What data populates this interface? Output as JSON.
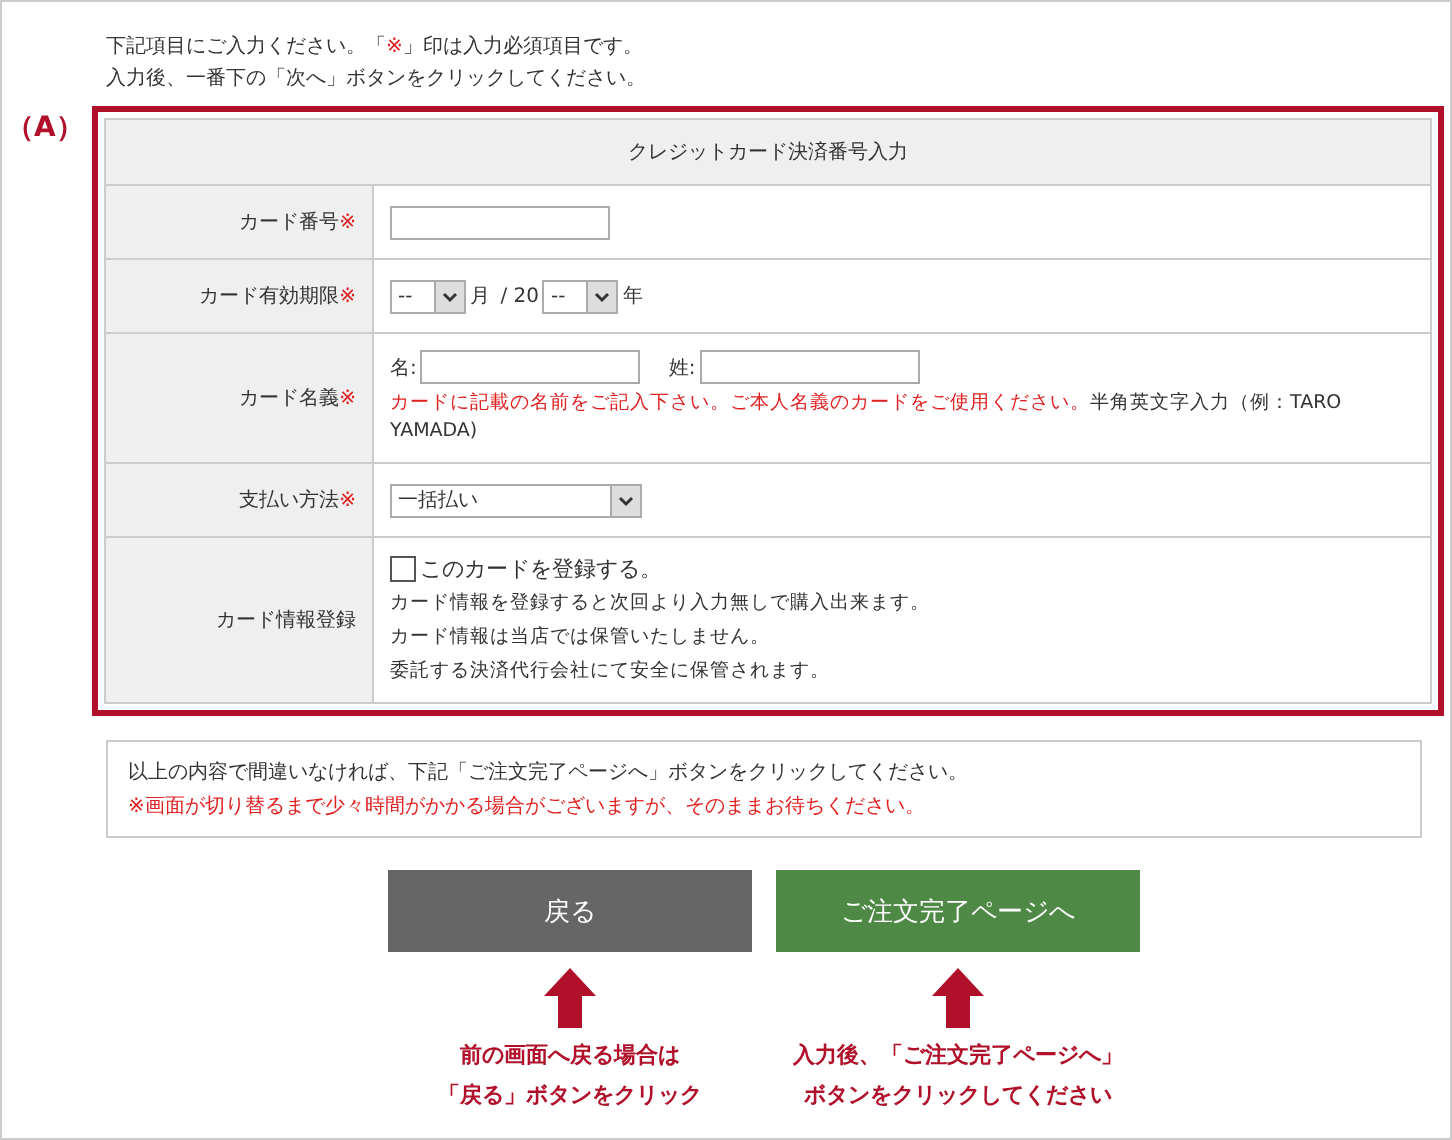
{
  "intro": [
    [
      {
        "kind": "plain",
        "text": "下記項目にご入力ください。「"
      },
      {
        "kind": "mark",
        "text": "※"
      },
      {
        "kind": "plain",
        "text": "」印は入力必須項目です。"
      }
    ],
    [
      {
        "kind": "plain",
        "text": "入力後、一番下の「次へ」ボタンをクリックしてください。"
      }
    ]
  ],
  "callout_label": "（A）",
  "form": {
    "title": "クレジットカード決済番号入力",
    "rows": [
      {
        "kind": "text",
        "label": "カード番号",
        "mark": "※"
      },
      {
        "kind": "expiry",
        "label": "カード有効期限",
        "mark": "※",
        "month": "--",
        "month_unit": "月",
        "separator": "/ 20",
        "year": "--",
        "year_unit": "年"
      },
      {
        "kind": "name",
        "label": "カード名義",
        "mark": "※",
        "first_label": "名:",
        "last_label": "姓:",
        "note": [
          {
            "kind": "mark",
            "text": "カードに記載の名前をご記入下さい。ご本人名義のカードをご使用ください。"
          },
          {
            "kind": "plain",
            "text": "半角英文字入力（例：TARO YAMADA)"
          }
        ]
      },
      {
        "kind": "select",
        "label": "支払い方法",
        "mark": "※",
        "value": "一括払い"
      },
      {
        "kind": "register",
        "label": "カード情報登録",
        "checkbox_label": "このカードを登録する。",
        "checked": false,
        "lines": [
          "カード情報を登録すると次回より入力無しで購入出来ます。",
          "カード情報は当店では保管いたしません。",
          "委託する決済代行会社にて安全に保管されます。"
        ]
      }
    ]
  },
  "notice": {
    "text": "以上の内容で間違いなければ、下記「ご注文完了ページへ」ボタンをクリックしてください。",
    "warning": "※画面が切り替るまで少々時間がかかる場合がございますが、そのままお待ちください。"
  },
  "buttons": [
    {
      "label": "戻る",
      "kind": "back",
      "caption": [
        "前の画面へ戻る場合は",
        "「戻る」ボタンをクリック"
      ]
    },
    {
      "label": "ご注文完了ページへ",
      "kind": "next",
      "caption": [
        "入力後、「ご注文完了ページへ」",
        "ボタンをクリックしてください"
      ]
    }
  ]
}
